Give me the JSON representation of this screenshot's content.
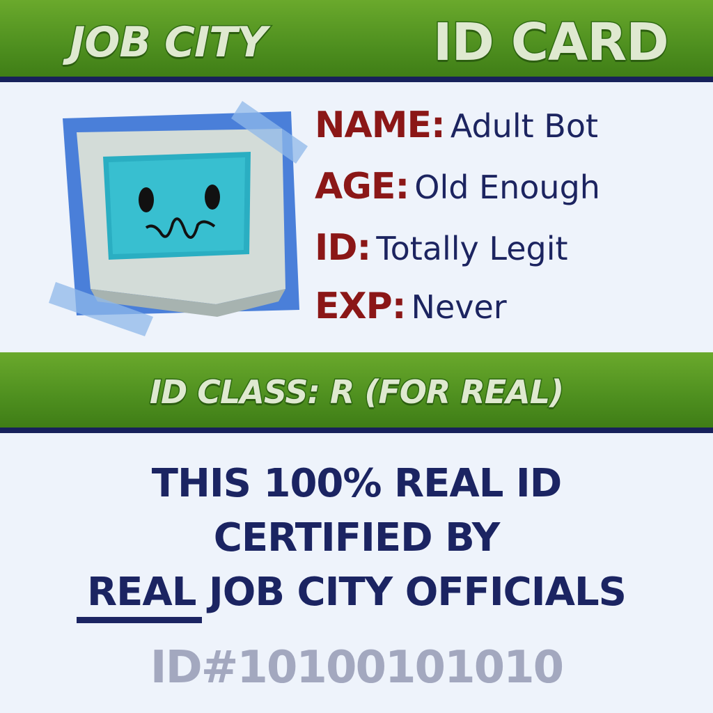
{
  "header": {
    "brand": "JOB CITY",
    "card_label": "ID CARD"
  },
  "fields": [
    {
      "key": "NAME:",
      "value": "Adult Bot"
    },
    {
      "key": "AGE:",
      "value": "Old Enough"
    },
    {
      "key": "ID:",
      "value": "Totally Legit"
    },
    {
      "key": "EXP:",
      "value": "Never"
    }
  ],
  "class_line": "ID CLASS: R (FOR REAL)",
  "certification": {
    "line1": "THIS 100% REAL ID",
    "line2": "CERTIFIED BY",
    "line3_emphasis": "REAL",
    "line3_rest": "JOB CITY OFFICIALS"
  },
  "serial": "ID#10100101010",
  "colors": {
    "band_green": "#4e8f1f",
    "navy": "#1b2462",
    "label_red": "#8b1717",
    "serial_gray": "#a3a8bf",
    "screen_cyan": "#2fb7c9"
  }
}
